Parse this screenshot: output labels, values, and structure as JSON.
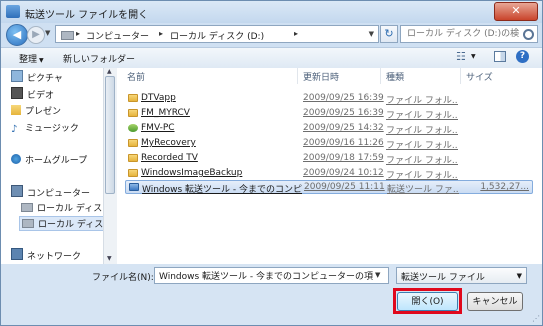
{
  "window": {
    "title": "転送ツール ファイルを開く",
    "close_label": "✕"
  },
  "address_bar": {
    "segments": [
      "コンピューター",
      "ローカル ディスク (D:)"
    ],
    "search_placeholder": "ローカル ディスク (D:)の検索"
  },
  "toolbar": {
    "organize_label": "整理",
    "new_folder_label": "新しいフォルダー"
  },
  "nav_pane": {
    "items": [
      {
        "label": "ピクチャ",
        "icon": "pictures-icon"
      },
      {
        "label": "ビデオ",
        "icon": "videos-icon"
      },
      {
        "label": "プレゼン",
        "icon": "presentation-folder-icon"
      },
      {
        "label": "ミュージック",
        "icon": "music-icon"
      },
      {
        "label": "ホームグループ",
        "icon": "homegroup-icon"
      },
      {
        "label": "コンピューター",
        "icon": "computer-icon"
      },
      {
        "label": "ローカル ディス",
        "icon": "drive-icon"
      },
      {
        "label": "ローカル ディス",
        "icon": "drive-icon"
      },
      {
        "label": "ネットワーク",
        "icon": "network-icon"
      }
    ]
  },
  "file_list": {
    "columns": [
      "名前",
      "更新日時",
      "種類",
      "サイズ"
    ],
    "rows": [
      {
        "name": "DTVapp",
        "date": "2009/09/25 16:39",
        "type": "ファイル フォル...",
        "size": "",
        "icon": "folder-icon"
      },
      {
        "name": "FM_MYRCV",
        "date": "2009/09/25 16:39",
        "type": "ファイル フォル...",
        "size": "",
        "icon": "folder-icon"
      },
      {
        "name": "FMV-PC",
        "date": "2009/09/25 14:32",
        "type": "ファイル フォル...",
        "size": "",
        "icon": "pc-folder-icon"
      },
      {
        "name": "MyRecovery",
        "date": "2009/09/16 11:26",
        "type": "ファイル フォル...",
        "size": "",
        "icon": "folder-icon"
      },
      {
        "name": "Recorded TV",
        "date": "2009/09/18 17:59",
        "type": "ファイル フォル...",
        "size": "",
        "icon": "folder-icon"
      },
      {
        "name": "WindowsImageBackup",
        "date": "2009/09/24 10:12",
        "type": "ファイル フォル...",
        "size": "",
        "icon": "folder-icon"
      },
      {
        "name": "Windows 転送ツール - 今までのコンピ...",
        "date": "2009/09/25 11:11",
        "type": "転送ツール ファ...",
        "size": "1,532,27...",
        "icon": "transfer-file-icon"
      }
    ]
  },
  "bottom": {
    "filename_label": "ファイル名(N):",
    "filename_value": "Windows 転送ツール - 今までのコンピューターの項目",
    "filetype_value": "転送ツール ファイル",
    "open_label": "開く(O)",
    "cancel_label": "キャンセル"
  },
  "colors": {
    "highlight_frame": "#e0081c",
    "selection": "#cadcf3"
  }
}
